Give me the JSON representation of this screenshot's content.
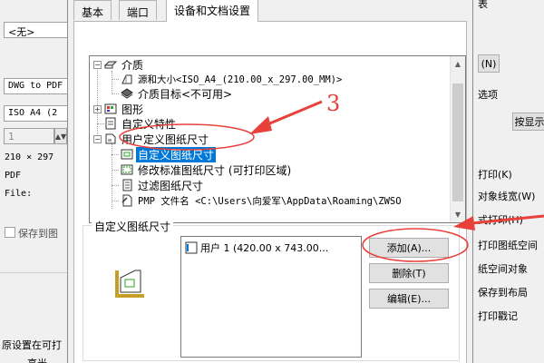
{
  "background": {
    "top_right_fragment": "表",
    "paper_combo": "<无>",
    "printer_combo": "DWG to PDF",
    "size_combo": "ISO A4 (2",
    "copies_value": "1",
    "size_info": "210 × 297",
    "pdf_label": "PDF",
    "file_label": "File:",
    "save_checkbox_label": "保存到图",
    "right_n_button": "(N)",
    "right_options_label": "选项",
    "right_show_button": "按显示",
    "right_items": [
      "打印(K)",
      "对象线宽(W)",
      "式打印(H)",
      "打印图纸空间",
      "纸空间对象",
      "保存到布局",
      "打印戳记"
    ],
    "bottom_left_text": "原设置在可打",
    "bottom_left_fragment": "高光"
  },
  "dialog": {
    "tabs": [
      "基本",
      "端口",
      "设备和文档设置"
    ],
    "active_tab": 2,
    "tree": [
      {
        "label": "介质",
        "icon": "media-icon"
      },
      {
        "label": "源和大小<ISO_A4_(210.00_x_297.00_MM)>",
        "icon": "paper-source-icon"
      },
      {
        "label": "介质目标<不可用>",
        "icon": "media-destination-icon"
      },
      {
        "label": "图形",
        "icon": "graphics-icon"
      },
      {
        "label": "自定义特性",
        "icon": "custom-properties-icon"
      },
      {
        "label": "用户定义图纸尺寸",
        "icon": "user-paper-sizes-icon"
      },
      {
        "label": "自定义图纸尺寸",
        "icon": "custom-paper-size-icon"
      },
      {
        "label": "修改标准图纸尺寸 (可打印区域)",
        "icon": "modify-paper-size-icon"
      },
      {
        "label": "过滤图纸尺寸",
        "icon": "filter-paper-size-icon"
      },
      {
        "label": "PMP 文件名 <C:\\Users\\向爱军\\AppData\\Roaming\\ZWSO",
        "icon": "pmp-file-icon"
      }
    ],
    "selected_tree_item": 6,
    "group_title": "自定义图纸尺寸",
    "size_list": [
      "用户 1 (420.00 x 743.00..."
    ],
    "buttons": {
      "add": "添加(A)...",
      "delete": "删除(T)",
      "edit": "编辑(E)..."
    }
  },
  "annotation": {
    "step_number": "3",
    "color": "#e8403a"
  }
}
